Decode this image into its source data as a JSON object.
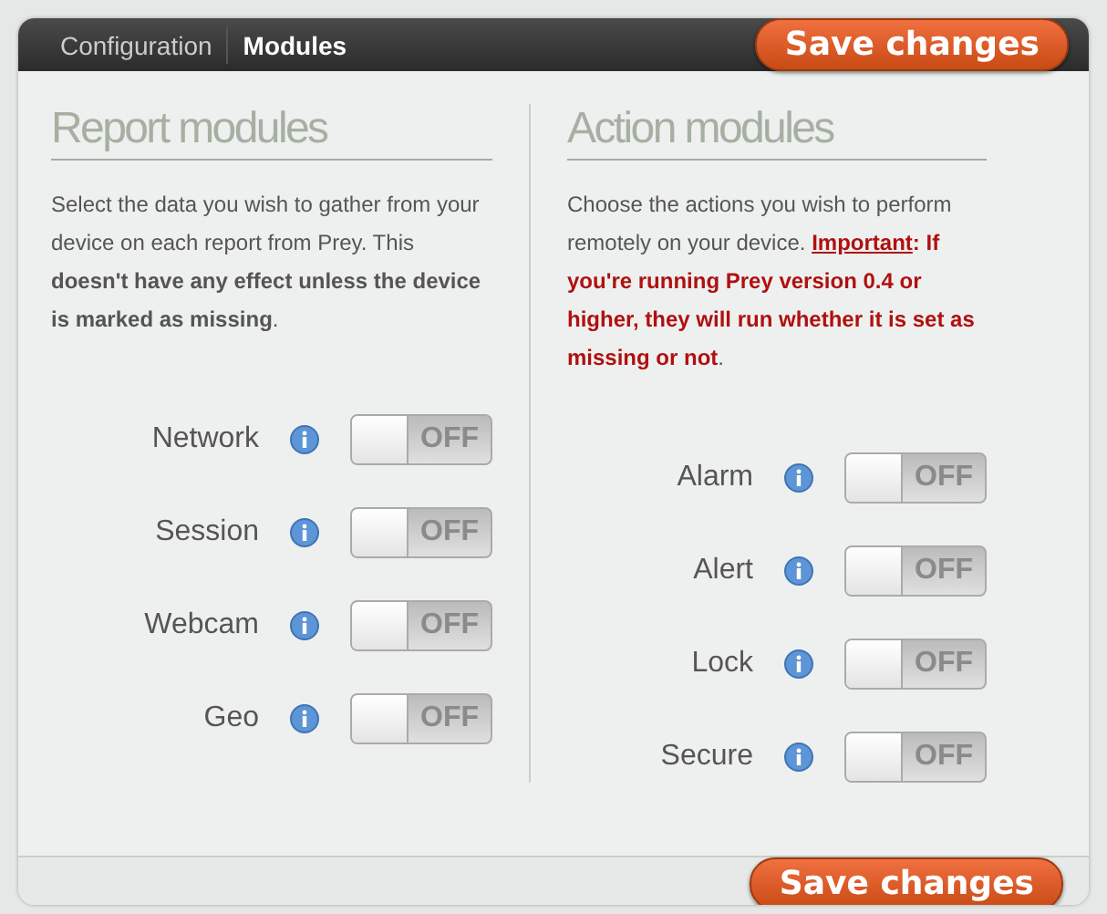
{
  "tabs": [
    {
      "label": "Configuration",
      "selected": false
    },
    {
      "label": "Modules",
      "selected": true
    }
  ],
  "save_button_top": "Save changes",
  "report_modules": {
    "title": "Report modules",
    "description": "Select the data you wish to gather from your device on each report from Prey. This **doesn't have any effect unless the device is marked as missing**.",
    "modules": [
      {
        "name": "Network",
        "toggle": "OFF",
        "on": false
      },
      {
        "name": "Session",
        "toggle": "OFF",
        "on": false
      },
      {
        "name": "Webcam",
        "toggle": "OFF",
        "on": false
      },
      {
        "name": "Geo",
        "toggle": "OFF",
        "on": false
      }
    ]
  },
  "action_modules": {
    "title": "Action modules",
    "description": {
      "text": "Choose the actions you wish to perform remotely on your device. ",
      "link": "Important",
      "warning": ": If you're running Prey version 0.4 or higher, they will run whether it is set as missing or not",
      "end": "."
    },
    "modules": [
      {
        "name": "Alarm",
        "toggle": "OFF",
        "on": false
      },
      {
        "name": "Alert",
        "toggle": "OFF",
        "on": false
      },
      {
        "name": "Lock",
        "toggle": "OFF",
        "on": false
      },
      {
        "name": "Secure",
        "toggle": "OFF",
        "on": false
      }
    ]
  },
  "save_button_bottom": "Save changes"
}
